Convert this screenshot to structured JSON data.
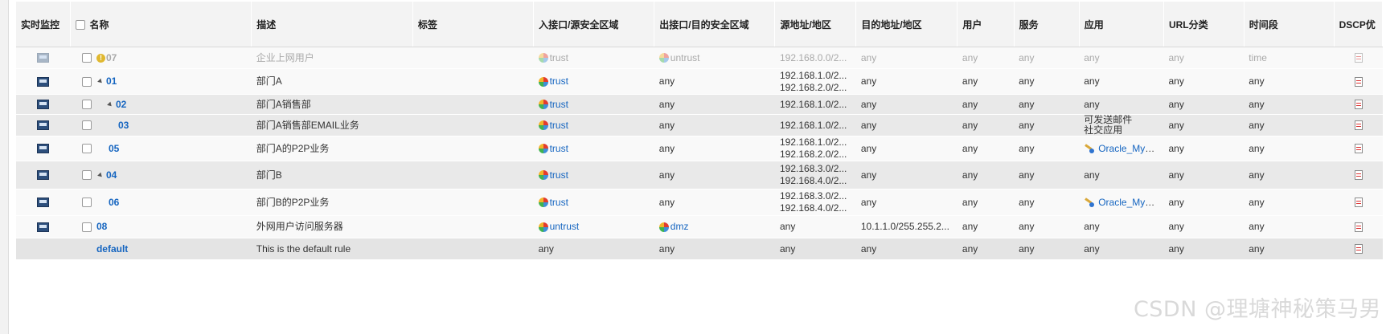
{
  "columns": {
    "monitor": "实时监控",
    "name": "名称",
    "description": "描述",
    "tag": "标签",
    "src_zone": "入接口/源安全区域",
    "dst_zone": "出接口/目的安全区域",
    "src_addr": "源地址/地区",
    "dst_addr": "目的地址/地区",
    "user": "用户",
    "service": "服务",
    "app": "应用",
    "url": "URL分类",
    "time": "时间段",
    "dscp": "DSCP优"
  },
  "rows": [
    {
      "name": "07",
      "description": "企业上网用户",
      "src_zone": "trust",
      "dst_zone": "untrust",
      "src_addr": [
        "192.168.0.0/2..."
      ],
      "dst_addr": "any",
      "user": "any",
      "service": "any",
      "app": [
        "any"
      ],
      "url": "any",
      "time": "time",
      "disabled": true
    },
    {
      "name": "01",
      "description": "部门A",
      "src_zone": "trust",
      "dst_zone": "any",
      "src_addr": [
        "192.168.1.0/2...",
        "192.168.2.0/2..."
      ],
      "dst_addr": "any",
      "user": "any",
      "service": "any",
      "app": [
        "any"
      ],
      "url": "any",
      "time": "any"
    },
    {
      "name": "02",
      "description": "部门A销售部",
      "src_zone": "trust",
      "dst_zone": "any",
      "src_addr": [
        "192.168.1.0/2..."
      ],
      "dst_addr": "any",
      "user": "any",
      "service": "any",
      "app": [
        "any"
      ],
      "url": "any",
      "time": "any"
    },
    {
      "name": "03",
      "description": "部门A销售部EMAIL业务",
      "src_zone": "trust",
      "dst_zone": "any",
      "src_addr": [
        "192.168.1.0/2..."
      ],
      "dst_addr": "any",
      "user": "any",
      "service": "any",
      "app": [
        "可发送邮件",
        "社交应用"
      ],
      "url": "any",
      "time": "any"
    },
    {
      "name": "05",
      "description": "部门A的P2P业务",
      "src_zone": "trust",
      "dst_zone": "any",
      "src_addr": [
        "192.168.1.0/2...",
        "192.168.2.0/2..."
      ],
      "dst_addr": "any",
      "user": "any",
      "service": "any",
      "app": [
        "Oracle_MySQL"
      ],
      "url": "any",
      "time": "any"
    },
    {
      "name": "04",
      "description": "部门B",
      "src_zone": "trust",
      "dst_zone": "any",
      "src_addr": [
        "192.168.3.0/2...",
        "192.168.4.0/2..."
      ],
      "dst_addr": "any",
      "user": "any",
      "service": "any",
      "app": [
        "any"
      ],
      "url": "any",
      "time": "any"
    },
    {
      "name": "06",
      "description": "部门B的P2P业务",
      "src_zone": "trust",
      "dst_zone": "any",
      "src_addr": [
        "192.168.3.0/2...",
        "192.168.4.0/2..."
      ],
      "dst_addr": "any",
      "user": "any",
      "service": "any",
      "app": [
        "Oracle_MySQL"
      ],
      "url": "any",
      "time": "any"
    },
    {
      "name": "08",
      "description": "外网用户访问服务器",
      "src_zone": "untrust",
      "dst_zone": "dmz",
      "src_addr": [
        "any"
      ],
      "dst_addr": "10.1.1.0/255.255.2...",
      "user": "any",
      "service": "any",
      "app": [
        "any"
      ],
      "url": "any",
      "time": "any"
    },
    {
      "name": "default",
      "description": "This is the default rule",
      "src_zone": "any",
      "dst_zone": "any",
      "src_addr": [
        "any"
      ],
      "dst_addr": "any",
      "user": "any",
      "service": "any",
      "app": [
        "any"
      ],
      "url": "any",
      "time": "any"
    }
  ],
  "watermark": "CSDN @理塘神秘策马男",
  "colors": {
    "link": "#1565c0",
    "disabled_text": "#a9a9a9",
    "time_red": "#b8221a",
    "header_bg": "#f3f3f3",
    "row_alt": "#e9e9e9"
  }
}
